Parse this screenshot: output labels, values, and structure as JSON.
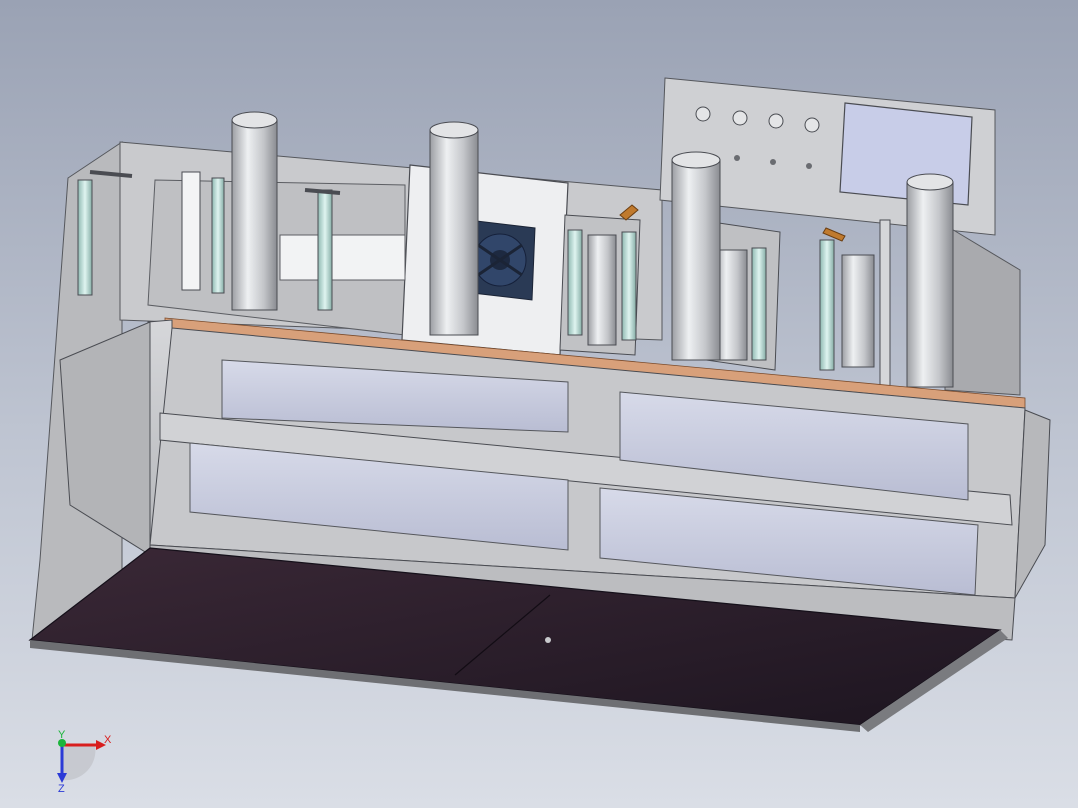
{
  "viewport": {
    "background_top": "#9aa2b4",
    "background_bottom": "#dadee6"
  },
  "model": {
    "frame_color": "#c9cacd",
    "panel_color": "#c4c8dc",
    "base_plate_color": "#2e1f2b",
    "cylinder_color": "#d2d3d6",
    "rod_color": "#bfe3dc",
    "accent_color": "#c07a2e",
    "control_panel": {
      "screen_color": "#c8cde8",
      "button_count": 4
    }
  },
  "triad": {
    "x_label": "X",
    "y_label": "Y",
    "z_label": "Z",
    "x_color": "#d81e1e",
    "y_color": "#1bb53c",
    "z_color": "#2b3ad6"
  }
}
